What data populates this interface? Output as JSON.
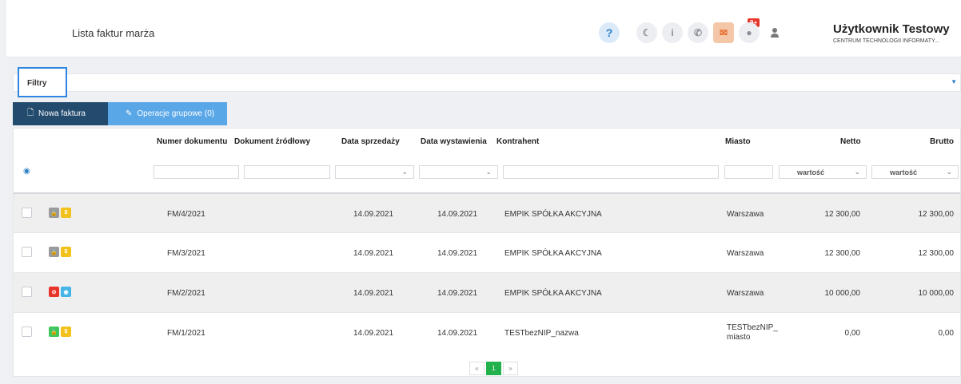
{
  "header": {
    "title": "Lista faktur marża",
    "icons": [
      "help-icon",
      "moon-icon",
      "info-icon",
      "phone-icon",
      "mail-icon",
      "globe-icon",
      "user-icon"
    ],
    "mail_badge": "9+",
    "user_name": "Użytkownik Testowy",
    "user_org": "CENTRUM TECHNOLOGII INFORMATY..."
  },
  "filters": {
    "label": "Filtry"
  },
  "toolbar": {
    "new_invoice": "Nowa faktura",
    "group_ops": "Operacje grupowe (0)"
  },
  "table": {
    "columns": [
      "Numer dokumentu",
      "Dokument źródłowy",
      "Data sprzedaży",
      "Data wystawienia",
      "Kontrahent",
      "Miasto",
      "Netto",
      "Brutto"
    ],
    "filter_placeholder_value": "wartość",
    "rows": [
      {
        "numer": "FM/4/2021",
        "zrodlowy": "",
        "data_sprzedazy": "14.09.2021",
        "data_wystawienia": "14.09.2021",
        "kontrahent": "EMPIK SPÓŁKA AKCYJNA",
        "miasto": "Warszawa",
        "netto": "12 300,00",
        "brutto": "12 300,00",
        "icons": [
          "lock-icon",
          "dollar-icon"
        ],
        "colors": [
          "#9a9a9a",
          "#f2c11b"
        ]
      },
      {
        "numer": "FM/3/2021",
        "zrodlowy": "",
        "data_sprzedazy": "14.09.2021",
        "data_wystawienia": "14.09.2021",
        "kontrahent": "EMPIK SPÓŁKA AKCYJNA",
        "miasto": "Warszawa",
        "netto": "12 300,00",
        "brutto": "12 300,00",
        "icons": [
          "lock-icon",
          "dollar-icon"
        ],
        "colors": [
          "#9a9a9a",
          "#f2c11b"
        ]
      },
      {
        "numer": "FM/2/2021",
        "zrodlowy": "",
        "data_sprzedazy": "14.09.2021",
        "data_wystawienia": "14.09.2021",
        "kontrahent": "EMPIK SPÓŁKA AKCYJNA",
        "miasto": "Warszawa",
        "netto": "10 000,00",
        "brutto": "10 000,00",
        "icons": [
          "ban-icon",
          "eye-icon"
        ],
        "colors": [
          "#e8352a",
          "#45b4e6"
        ]
      },
      {
        "numer": "FM/1/2021",
        "zrodlowy": "",
        "data_sprzedazy": "14.09.2021",
        "data_wystawienia": "14.09.2021",
        "kontrahent": "TESTbezNIP_nazwa",
        "miasto": "TESTbezNIP_\nmiasto",
        "netto": "0,00",
        "brutto": "0,00",
        "icons": [
          "unlock-icon",
          "dollar-icon"
        ],
        "colors": [
          "#3fc85a",
          "#f2c11b"
        ]
      }
    ]
  },
  "pagination": {
    "prev": "«",
    "current": "1",
    "next": "»"
  }
}
